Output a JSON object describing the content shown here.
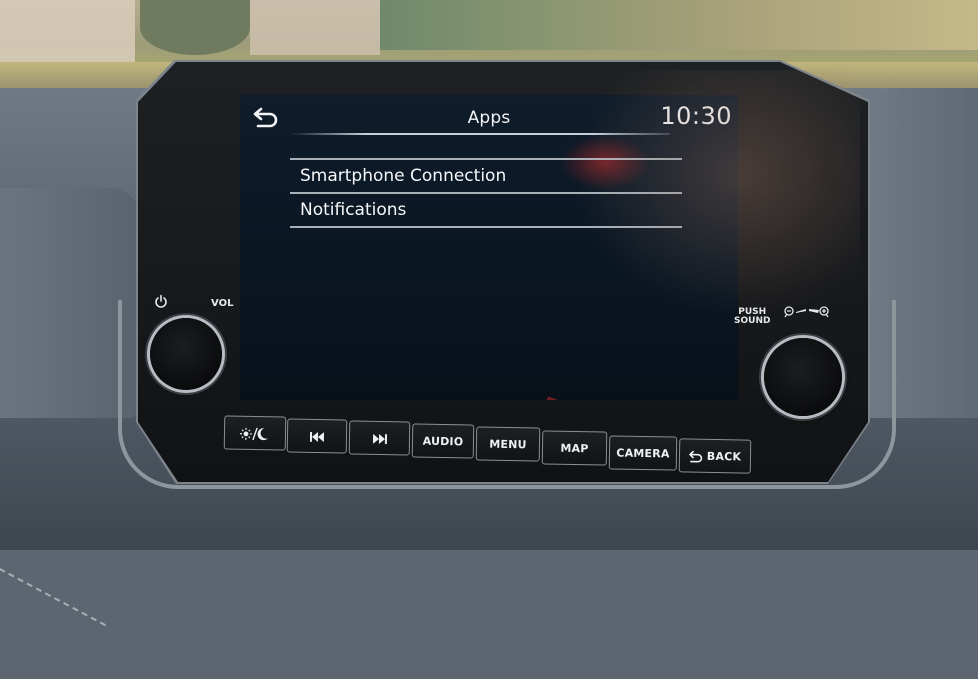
{
  "screen": {
    "title": "Apps",
    "clock": "10:30",
    "back_icon": "back-arrow-icon",
    "menu_items": [
      {
        "label": "Smartphone Connection"
      },
      {
        "label": "Notifications"
      }
    ]
  },
  "controls": {
    "power_icon": "power-icon",
    "vol_label": "VOL",
    "push_sound_line1": "PUSH",
    "push_sound_line2": "SOUND",
    "zoom_scale_icon": "zoom-out-in-scale-icon"
  },
  "hard_buttons": [
    {
      "id": "day-night",
      "label": "",
      "icon": "sun-moon-icon"
    },
    {
      "id": "previous-track",
      "label": "",
      "icon": "skip-previous-icon"
    },
    {
      "id": "next-track",
      "label": "",
      "icon": "skip-next-icon"
    },
    {
      "id": "audio",
      "label": "AUDIO",
      "icon": ""
    },
    {
      "id": "menu",
      "label": "MENU",
      "icon": ""
    },
    {
      "id": "map",
      "label": "MAP",
      "icon": ""
    },
    {
      "id": "camera",
      "label": "CAMERA",
      "icon": ""
    },
    {
      "id": "back",
      "label": "BACK",
      "icon": "back-arrow-icon"
    }
  ],
  "colors": {
    "screen_background": "#0b1723",
    "screen_text": "#f4f6f8",
    "divider": "#c7d0d8",
    "bezel": "#16181b",
    "button_border": "#8a9096"
  }
}
